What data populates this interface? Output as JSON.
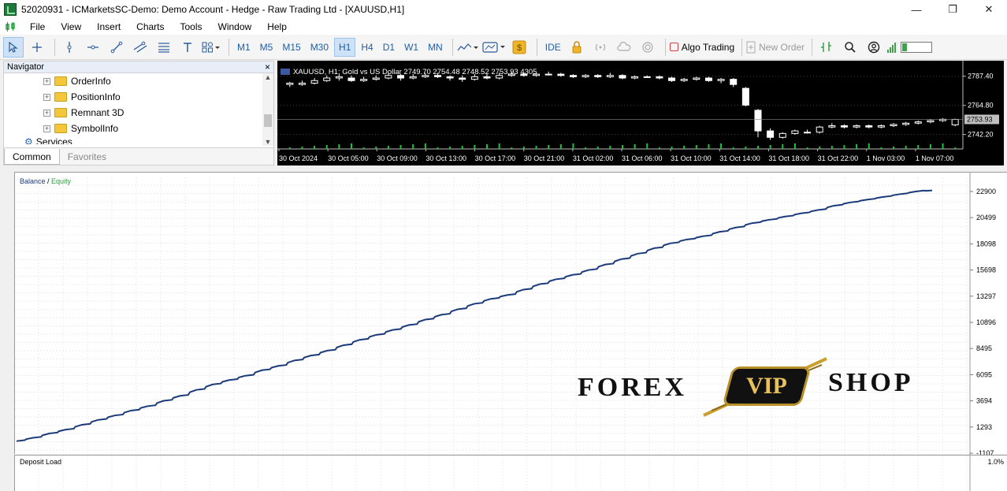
{
  "window": {
    "title": "52020931 - ICMarketsSC-Demo: Demo Account - Hedge - Raw Trading Ltd - [XAUUSD,H1]",
    "controls": [
      "—",
      "❐",
      "✕"
    ]
  },
  "menu": {
    "items": [
      "File",
      "View",
      "Insert",
      "Charts",
      "Tools",
      "Window",
      "Help"
    ]
  },
  "toolbar": {
    "timeframes": [
      "M1",
      "M5",
      "M15",
      "M30",
      "H1",
      "H4",
      "D1",
      "W1",
      "MN"
    ],
    "active_timeframe": "H1",
    "ide_label": "IDE",
    "algo_trading_label": "Algo Trading",
    "new_order_label": "New Order",
    "icons": {
      "cursor": "cursor-icon",
      "crosshair": "crosshair-icon",
      "vline": "vertical-line-icon",
      "hline": "horizontal-line-icon",
      "trendline": "trendline-icon",
      "channel": "channel-icon",
      "fibo": "fibo-icon",
      "text": "text-icon",
      "shapes": "shapes-icon"
    }
  },
  "navigator": {
    "title": "Navigator",
    "items": [
      "OrderInfo",
      "PositionInfo",
      "Remnant 3D",
      "SymbolInfo"
    ],
    "partial_item": "Services",
    "tabs": [
      "Common",
      "Favorites"
    ],
    "active_tab": "Common"
  },
  "price_chart": {
    "label": "XAUUSD, H1:  Gold vs US Dollar  2749.70 2754.48 2748.52 2753.93  4305",
    "current_price": "2753.93",
    "colors": {
      "bg": "#000000",
      "up": "#ffffff",
      "down": "#ffffff",
      "axis": "#ffffff"
    },
    "chart_data": {
      "type": "candlestick",
      "y_ticks": [
        "2787.40",
        "2764.80",
        "2742.20"
      ],
      "y_tick_values": [
        2787.4,
        2764.8,
        2742.2
      ],
      "ylim": [
        2731,
        2797
      ],
      "x_ticks": [
        "30 Oct 2024",
        "30 Oct 05:00",
        "30 Oct 09:00",
        "30 Oct 13:00",
        "30 Oct 17:00",
        "30 Oct 21:00",
        "31 Oct 02:00",
        "31 Oct 06:00",
        "31 Oct 10:00",
        "31 Oct 14:00",
        "31 Oct 18:00",
        "31 Oct 22:00",
        "1 Nov 03:00",
        "1 Nov 07:00"
      ],
      "candles": [
        {
          "o": 2781,
          "c": 2782,
          "h": 2783,
          "l": 2779
        },
        {
          "o": 2781,
          "c": 2782,
          "h": 2784,
          "l": 2780
        },
        {
          "o": 2782,
          "c": 2784,
          "h": 2786,
          "l": 2781
        },
        {
          "o": 2784,
          "c": 2786,
          "h": 2788,
          "l": 2783
        },
        {
          "o": 2786,
          "c": 2787,
          "h": 2789,
          "l": 2784
        },
        {
          "o": 2786,
          "c": 2784,
          "h": 2788,
          "l": 2783
        },
        {
          "o": 2784,
          "c": 2785,
          "h": 2787,
          "l": 2783
        },
        {
          "o": 2785,
          "c": 2786,
          "h": 2788,
          "l": 2784
        },
        {
          "o": 2786,
          "c": 2788,
          "h": 2790,
          "l": 2785
        },
        {
          "o": 2788,
          "c": 2786,
          "h": 2789,
          "l": 2784
        },
        {
          "o": 2786,
          "c": 2787,
          "h": 2789,
          "l": 2785
        },
        {
          "o": 2787,
          "c": 2788,
          "h": 2790,
          "l": 2786
        },
        {
          "o": 2788,
          "c": 2787,
          "h": 2790,
          "l": 2786
        },
        {
          "o": 2787,
          "c": 2786,
          "h": 2788,
          "l": 2784
        },
        {
          "o": 2786,
          "c": 2785,
          "h": 2788,
          "l": 2783
        },
        {
          "o": 2785,
          "c": 2787,
          "h": 2789,
          "l": 2784
        },
        {
          "o": 2787,
          "c": 2786,
          "h": 2789,
          "l": 2785
        },
        {
          "o": 2786,
          "c": 2788,
          "h": 2790,
          "l": 2785
        },
        {
          "o": 2788,
          "c": 2789,
          "h": 2791,
          "l": 2787
        },
        {
          "o": 2789,
          "c": 2788,
          "h": 2790,
          "l": 2787
        },
        {
          "o": 2788,
          "c": 2789,
          "h": 2790,
          "l": 2787
        },
        {
          "o": 2789,
          "c": 2789,
          "h": 2791,
          "l": 2788
        },
        {
          "o": 2789,
          "c": 2788,
          "h": 2790,
          "l": 2787
        },
        {
          "o": 2788,
          "c": 2787,
          "h": 2789,
          "l": 2786
        },
        {
          "o": 2787,
          "c": 2788,
          "h": 2789,
          "l": 2786
        },
        {
          "o": 2788,
          "c": 2787,
          "h": 2789,
          "l": 2786
        },
        {
          "o": 2787,
          "c": 2788,
          "h": 2790,
          "l": 2786
        },
        {
          "o": 2788,
          "c": 2786,
          "h": 2789,
          "l": 2785
        },
        {
          "o": 2786,
          "c": 2787,
          "h": 2788,
          "l": 2785
        },
        {
          "o": 2787,
          "c": 2787,
          "h": 2788,
          "l": 2786
        },
        {
          "o": 2787,
          "c": 2786,
          "h": 2788,
          "l": 2785
        },
        {
          "o": 2786,
          "c": 2784,
          "h": 2787,
          "l": 2783
        },
        {
          "o": 2784,
          "c": 2785,
          "h": 2786,
          "l": 2783
        },
        {
          "o": 2785,
          "c": 2786,
          "h": 2787,
          "l": 2784
        },
        {
          "o": 2786,
          "c": 2784,
          "h": 2787,
          "l": 2783
        },
        {
          "o": 2784,
          "c": 2785,
          "h": 2786,
          "l": 2782
        },
        {
          "o": 2785,
          "c": 2781,
          "h": 2786,
          "l": 2779
        },
        {
          "o": 2778,
          "c": 2765,
          "h": 2779,
          "l": 2764
        },
        {
          "o": 2761,
          "c": 2745,
          "h": 2762,
          "l": 2740
        },
        {
          "o": 2745,
          "c": 2740,
          "h": 2747,
          "l": 2738
        },
        {
          "o": 2740,
          "c": 2743,
          "h": 2744,
          "l": 2739
        },
        {
          "o": 2743,
          "c": 2745,
          "h": 2746,
          "l": 2742
        },
        {
          "o": 2744,
          "c": 2744,
          "h": 2746,
          "l": 2743
        },
        {
          "o": 2744,
          "c": 2748,
          "h": 2749,
          "l": 2743
        },
        {
          "o": 2748,
          "c": 2749,
          "h": 2751,
          "l": 2747
        },
        {
          "o": 2749,
          "c": 2748,
          "h": 2750,
          "l": 2747
        },
        {
          "o": 2748,
          "c": 2749,
          "h": 2750,
          "l": 2747
        },
        {
          "o": 2749,
          "c": 2748,
          "h": 2750,
          "l": 2747
        },
        {
          "o": 2748,
          "c": 2749,
          "h": 2750,
          "l": 2747
        },
        {
          "o": 2749,
          "c": 2750,
          "h": 2751,
          "l": 2748
        },
        {
          "o": 2750,
          "c": 2751,
          "h": 2752,
          "l": 2749
        },
        {
          "o": 2751,
          "c": 2752,
          "h": 2753,
          "l": 2750
        },
        {
          "o": 2752,
          "c": 2753,
          "h": 2754,
          "l": 2751
        },
        {
          "o": 2753,
          "c": 2754,
          "h": 2755,
          "l": 2752
        },
        {
          "o": 2749.7,
          "c": 2753.93,
          "h": 2754.48,
          "l": 2748.52
        }
      ]
    }
  },
  "balance_chart": {
    "legend_balance": "Balance",
    "legend_sep": " / ",
    "legend_equity": "Equity",
    "colors": {
      "balance": "#1a3a7a",
      "equity": "#2aa040",
      "grid": "#e6e6e6"
    },
    "chart_data": {
      "type": "line",
      "y_ticks": [
        "22900",
        "20499",
        "18098",
        "15698",
        "13297",
        "10896",
        "8495",
        "6095",
        "3694",
        "1293",
        "-1107"
      ],
      "ylim": [
        -1107,
        24200
      ],
      "series": [
        {
          "name": "Balance",
          "values": [
            0,
            300,
            700,
            1050,
            1500,
            1950,
            2350,
            2800,
            3200,
            3700,
            4150,
            4700,
            5200,
            5600,
            6000,
            6500,
            6900,
            7400,
            7850,
            8300,
            8800,
            9300,
            9750,
            10200,
            10650,
            11150,
            11600,
            12100,
            12600,
            13050,
            13400,
            13900,
            14400,
            14850,
            15250,
            15700,
            16200,
            16700,
            17200,
            17700,
            18150,
            18500,
            18800,
            19200,
            19600,
            20000,
            20300,
            20600,
            20900,
            21200,
            21600,
            21900,
            22150,
            22400,
            22650,
            22900,
            23000
          ]
        }
      ]
    },
    "watermark": {
      "left": "FOREX",
      "badge": "VIP",
      "right": "SHOP"
    }
  },
  "deposit_load": {
    "label": "Deposit Load",
    "axis_top": "1.0%"
  }
}
